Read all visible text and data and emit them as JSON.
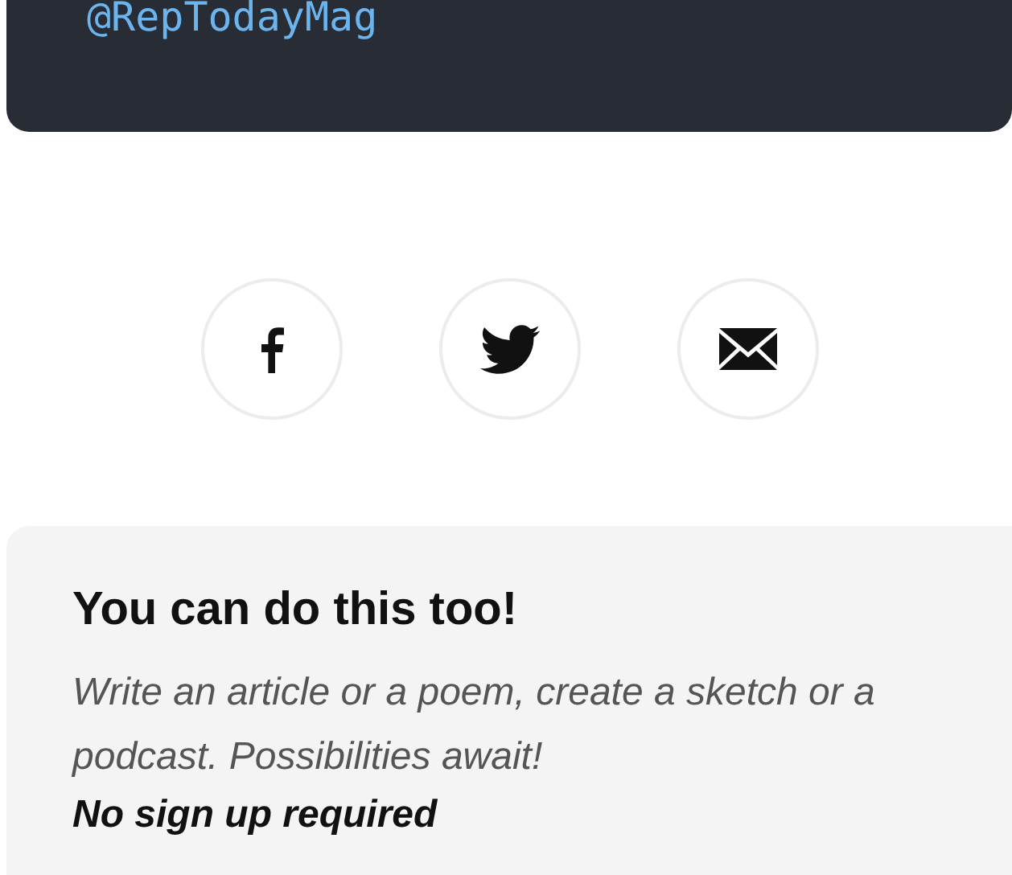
{
  "profile_card": {
    "handle": "@RepTodayMag"
  },
  "share_buttons": [
    {
      "kind": "facebook"
    },
    {
      "kind": "twitter"
    },
    {
      "kind": "email"
    }
  ],
  "cta_card": {
    "title": "You can do this too!",
    "text": "Write an article or a poem, create a sketch or a podcast. Possibilities await!",
    "note": "No sign up required"
  }
}
